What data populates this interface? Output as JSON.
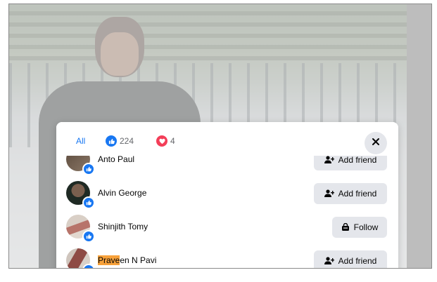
{
  "reactions_dialog": {
    "tabs": [
      {
        "label": "All"
      },
      {
        "count": "224",
        "icon": "like-reaction-icon"
      },
      {
        "count": "4",
        "icon": "love-reaction-icon"
      }
    ],
    "close_icon": "close-icon",
    "people": [
      {
        "name": "Anto Paul",
        "action": "Add friend",
        "action_icon": "person-plus-icon"
      },
      {
        "name": "Alvin George",
        "action": "Add friend",
        "action_icon": "person-plus-icon"
      },
      {
        "name": "Shinjith Tomy",
        "action": "Follow",
        "action_icon": "follow-icon"
      },
      {
        "name_highlight": "Prave",
        "name_rest": "en N Pavi",
        "action": "Add friend",
        "action_icon": "person-plus-icon"
      }
    ]
  },
  "colors": {
    "accent_blue": "#1877f2",
    "love_red": "#f33e58",
    "button_gray": "#e4e6eb",
    "highlight": "#f7a13a"
  }
}
